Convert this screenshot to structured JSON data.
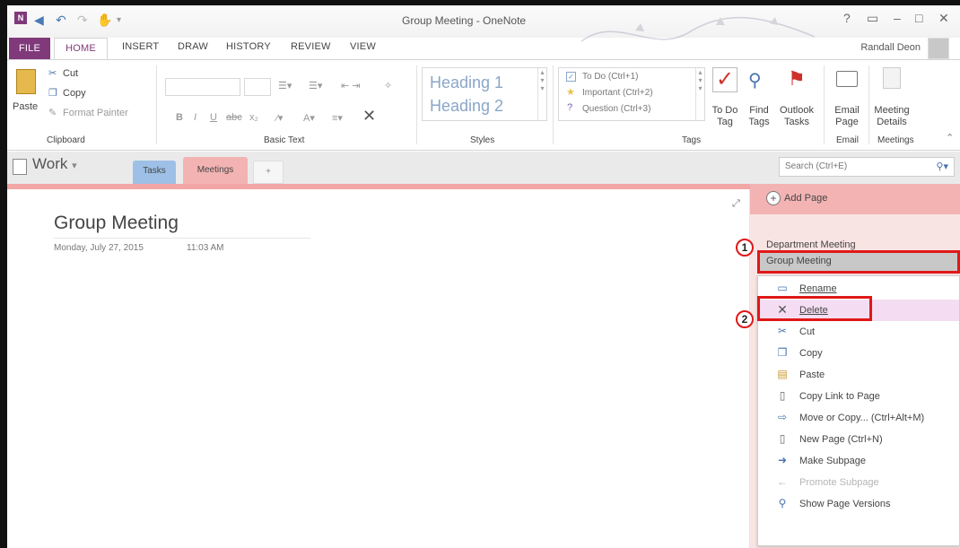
{
  "window": {
    "title": "Group Meeting - OneNote"
  },
  "ribbon_tabs": [
    "FILE",
    "HOME",
    "INSERT",
    "DRAW",
    "HISTORY",
    "REVIEW",
    "VIEW"
  ],
  "user": {
    "name": "Randall Deon"
  },
  "ribbon": {
    "clipboard": {
      "paste": "Paste",
      "cut": "Cut",
      "copy": "Copy",
      "format_painter": "Format Painter",
      "label": "Clipboard"
    },
    "basic_text": {
      "label": "Basic Text"
    },
    "styles": {
      "heading1": "Heading 1",
      "heading2": "Heading 2",
      "label": "Styles"
    },
    "tags": {
      "items": [
        "To Do (Ctrl+1)",
        "Important (Ctrl+2)",
        "Question (Ctrl+3)"
      ],
      "todo_tag": "To Do Tag",
      "find_tags": "Find Tags",
      "outlook_tasks": "Outlook Tasks",
      "label": "Tags"
    },
    "email": {
      "email_page": "Email Page",
      "label": "Email"
    },
    "meetings": {
      "meeting_details": "Meeting Details",
      "label": "Meetings"
    }
  },
  "notebook": {
    "name": "Work",
    "sections": [
      "Tasks",
      "Meetings"
    ],
    "add_section": "+",
    "search_placeholder": "Search (Ctrl+E)"
  },
  "page": {
    "title": "Group Meeting",
    "date": "Monday, July 27, 2015",
    "time": "11:03 AM"
  },
  "pages_pane": {
    "add_page": "Add Page",
    "pages": [
      "Department Meeting",
      "Group Meeting"
    ]
  },
  "context_menu": {
    "items": [
      {
        "label": "Rename",
        "icon": "rename-icon"
      },
      {
        "label": "Delete",
        "icon": "delete-x-icon"
      },
      {
        "label": "Cut",
        "icon": "scissors-icon"
      },
      {
        "label": "Copy",
        "icon": "copy-icon"
      },
      {
        "label": "Paste",
        "icon": "paste-icon"
      },
      {
        "label": "Copy Link to Page",
        "icon": "link-icon"
      },
      {
        "label": "Move or Copy...  (Ctrl+Alt+M)",
        "icon": "move-icon"
      },
      {
        "label": "New Page  (Ctrl+N)",
        "icon": "new-page-icon"
      },
      {
        "label": "Make Subpage",
        "icon": "arrow-right-icon"
      },
      {
        "label": "Promote Subpage",
        "icon": "arrow-left-icon",
        "disabled": true
      },
      {
        "label": "Show Page Versions",
        "icon": "versions-icon"
      }
    ]
  },
  "callouts": [
    "1",
    "2"
  ]
}
